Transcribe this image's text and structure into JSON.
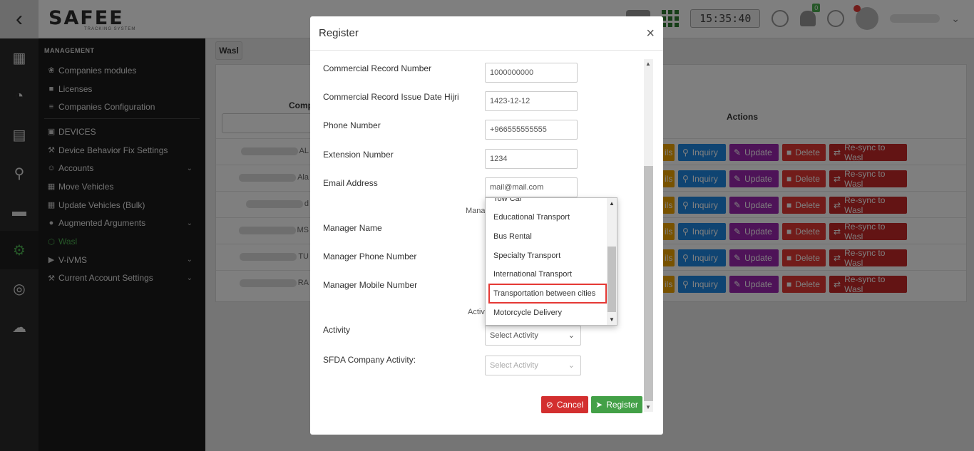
{
  "topbar": {
    "back_icon": "chevron-left-icon",
    "logo_text": "SAFEE",
    "logo_sub": "TRACKING SYSTEM",
    "clock": "15:35:40",
    "notifications_count": "0"
  },
  "menu": {
    "section_title": "MANAGEMENT",
    "items": [
      {
        "label": "Companies modules",
        "icon": "modules-icon"
      },
      {
        "label": "Licenses",
        "icon": "lock-icon"
      },
      {
        "label": "Companies Configuration",
        "icon": "sliders-icon"
      },
      {
        "label": "DEVICES",
        "icon": "device-icon"
      },
      {
        "label": "Device Behavior Fix Settings",
        "icon": "wrench-icon"
      },
      {
        "label": "Accounts",
        "icon": "users-icon"
      },
      {
        "label": "Move Vehicles",
        "icon": "move-icon"
      },
      {
        "label": "Update Vehicles (Bulk)",
        "icon": "bulk-icon"
      },
      {
        "label": "Augmented Arguments",
        "icon": "circle-icon"
      },
      {
        "label": "Wasl",
        "icon": "wasl-icon"
      },
      {
        "label": "V-iVMS",
        "icon": "video-icon"
      },
      {
        "label": "Current Account Settings",
        "icon": "wrench-icon"
      }
    ]
  },
  "content": {
    "tab_label": "Wasl",
    "col_company": "Compa",
    "col_actions": "Actions",
    "rows": [
      {
        "name_tail": "AL"
      },
      {
        "name_tail": "Ala"
      },
      {
        "name_tail": "d"
      },
      {
        "name_tail": "MS"
      },
      {
        "name_tail": "TU"
      },
      {
        "name_tail": "RA"
      }
    ],
    "actions": {
      "details": "ils",
      "inquiry": "Inquiry",
      "update": "Update",
      "delete": "Delete",
      "resync": "Re-sync to Wasl"
    }
  },
  "modal": {
    "title": "Register",
    "close": "×",
    "fields": {
      "commercial_record_number": {
        "label": "Commercial Record Number",
        "value": "1000000000"
      },
      "commercial_record_issue_date": {
        "label": "Commercial Record Issue Date Hijri",
        "value": "1423-12-12"
      },
      "phone_number": {
        "label": "Phone Number",
        "value": "+966555555555"
      },
      "extension_number": {
        "label": "Extension Number",
        "value": "1234"
      },
      "email_address": {
        "label": "Email Address",
        "value": "mail@mail.com"
      },
      "manager_name": {
        "label": "Manager Name"
      },
      "manager_phone": {
        "label": "Manager Phone Number"
      },
      "manager_mobile": {
        "label": "Manager Mobile Number"
      },
      "activity": {
        "label": "Activity",
        "value": "Select Activity"
      },
      "sfda_activity": {
        "label": "SFDA Company Activity:",
        "value": "Select Activity"
      }
    },
    "partial_labels": {
      "manager": "Mana",
      "activity": "Activi"
    },
    "cancel_label": "Cancel",
    "register_label": "Register"
  },
  "dropdown": {
    "options": [
      "Tow Car",
      "Educational Transport",
      "Bus Rental",
      "Specialty Transport",
      "International Transport",
      "Transportation between cities",
      "Motorcycle Delivery"
    ],
    "highlighted": "Transportation between cities"
  }
}
